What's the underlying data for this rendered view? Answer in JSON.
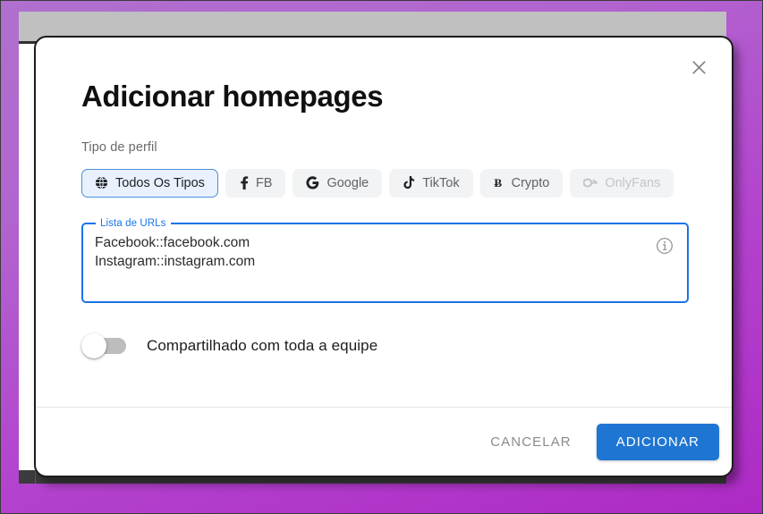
{
  "dialog": {
    "title": "Adicionar homepages",
    "close_icon": "close-icon",
    "profile_type_label": "Tipo de perfil",
    "chips": [
      {
        "label": "Todos Os Tipos",
        "icon": "globe-icon",
        "glyph": "⊕",
        "selected": true,
        "disabled": false
      },
      {
        "label": "FB",
        "icon": "facebook-icon",
        "glyph": "f",
        "selected": false,
        "disabled": false
      },
      {
        "label": "Google",
        "icon": "google-icon",
        "glyph": "G",
        "selected": false,
        "disabled": false
      },
      {
        "label": "TikTok",
        "icon": "tiktok-icon",
        "glyph": "♪",
        "selected": false,
        "disabled": false
      },
      {
        "label": "Crypto",
        "icon": "bitcoin-icon",
        "glyph": "Ƀ",
        "selected": false,
        "disabled": false
      },
      {
        "label": "OnlyFans",
        "icon": "onlyfans-icon",
        "glyph": "☞",
        "selected": false,
        "disabled": true
      }
    ],
    "urls_field": {
      "legend": "Lista de URLs",
      "value": "Facebook::facebook.com\nInstagram::instagram.com",
      "info_icon": "info-icon",
      "focused": true
    },
    "share_switch": {
      "label": "Compartilhado com toda a equipe",
      "checked": false
    },
    "footer": {
      "cancel_label": "CANCELAR",
      "submit_label": "ADICIONAR"
    }
  },
  "colors": {
    "accent_blue": "#1f76d2",
    "focus_blue": "#1a73e8",
    "chip_selected_bg": "#e8f1fd",
    "chip_bg": "#f1f3f4",
    "backdrop_purple": "#b343ce",
    "disabled_grey": "#c3c5c7"
  }
}
